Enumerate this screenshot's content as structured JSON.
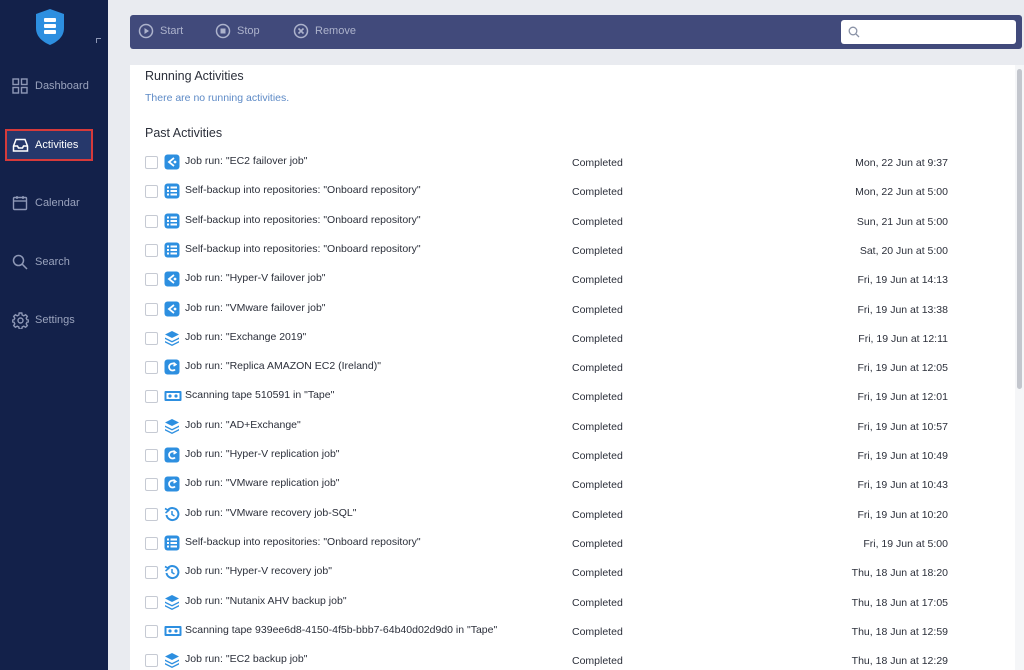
{
  "sidebar": {
    "items": [
      {
        "label": "Dashboard",
        "icon": "grid-icon"
      },
      {
        "label": "Activities",
        "icon": "inbox-icon",
        "active": true
      },
      {
        "label": "Calendar",
        "icon": "calendar-icon"
      },
      {
        "label": "Search",
        "icon": "search-icon"
      },
      {
        "label": "Settings",
        "icon": "gear-icon"
      }
    ]
  },
  "toolbar": {
    "start_label": "Start",
    "stop_label": "Stop",
    "remove_label": "Remove",
    "search_placeholder": ""
  },
  "running": {
    "title": "Running Activities",
    "empty_text": "There are no running activities."
  },
  "past": {
    "title": "Past Activities",
    "rows": [
      {
        "icon": "failover-icon",
        "name": "Job run: \"EC2 failover job\"",
        "status": "Completed",
        "time": "Mon, 22 Jun at 9:37"
      },
      {
        "icon": "self-backup-icon",
        "name": "Self-backup into repositories: \"Onboard repository\"",
        "status": "Completed",
        "time": "Mon, 22 Jun at 5:00"
      },
      {
        "icon": "self-backup-icon",
        "name": "Self-backup into repositories: \"Onboard repository\"",
        "status": "Completed",
        "time": "Sun, 21 Jun at 5:00"
      },
      {
        "icon": "self-backup-icon",
        "name": "Self-backup into repositories: \"Onboard repository\"",
        "status": "Completed",
        "time": "Sat, 20 Jun at 5:00"
      },
      {
        "icon": "failover-icon",
        "name": "Job run: \"Hyper-V failover job\"",
        "status": "Completed",
        "time": "Fri, 19 Jun at 14:13"
      },
      {
        "icon": "failover-icon",
        "name": "Job run: \"VMware failover job\"",
        "status": "Completed",
        "time": "Fri, 19 Jun at 13:38"
      },
      {
        "icon": "backup-stack-icon",
        "name": "Job run: \"Exchange 2019\"",
        "status": "Completed",
        "time": "Fri, 19 Jun at 12:11"
      },
      {
        "icon": "replication-icon",
        "name": "Job run: \"Replica AMAZON EC2 (Ireland)\"",
        "status": "Completed",
        "time": "Fri, 19 Jun at 12:05"
      },
      {
        "icon": "tape-icon",
        "name": "Scanning tape 510591 in \"Tape\"",
        "status": "Completed",
        "time": "Fri, 19 Jun at 12:01"
      },
      {
        "icon": "backup-stack-icon",
        "name": "Job run: \"AD+Exchange\"",
        "status": "Completed",
        "time": "Fri, 19 Jun at 10:57"
      },
      {
        "icon": "replication-icon",
        "name": "Job run: \"Hyper-V replication job\"",
        "status": "Completed",
        "time": "Fri, 19 Jun at 10:49"
      },
      {
        "icon": "replication-icon",
        "name": "Job run: \"VMware replication job\"",
        "status": "Completed",
        "time": "Fri, 19 Jun at 10:43"
      },
      {
        "icon": "recovery-icon",
        "name": "Job run: \"VMware recovery job-SQL\"",
        "status": "Completed",
        "time": "Fri, 19 Jun at 10:20"
      },
      {
        "icon": "self-backup-icon",
        "name": "Self-backup into repositories: \"Onboard repository\"",
        "status": "Completed",
        "time": "Fri, 19 Jun at 5:00"
      },
      {
        "icon": "recovery-icon",
        "name": "Job run: \"Hyper-V recovery job\"",
        "status": "Completed",
        "time": "Thu, 18 Jun at 18:20"
      },
      {
        "icon": "backup-stack-icon",
        "name": "Job run: \"Nutanix AHV backup job\"",
        "status": "Completed",
        "time": "Thu, 18 Jun at 17:05"
      },
      {
        "icon": "tape-icon",
        "name": "Scanning tape 939ee6d8-4150-4f5b-bbb7-64b40d02d9d0 in \"Tape\"",
        "status": "Completed",
        "time": "Thu, 18 Jun at 12:59"
      },
      {
        "icon": "backup-stack-icon",
        "name": "Job run: \"EC2 backup job\"",
        "status": "Completed",
        "time": "Thu, 18 Jun at 12:29"
      }
    ]
  },
  "colors": {
    "sidebar_bg": "#13214a",
    "toolbar_bg": "#414a7b",
    "accent_blue": "#2d8fe0",
    "active_border": "#d63a3a",
    "link_blue": "#5d8ac6"
  }
}
